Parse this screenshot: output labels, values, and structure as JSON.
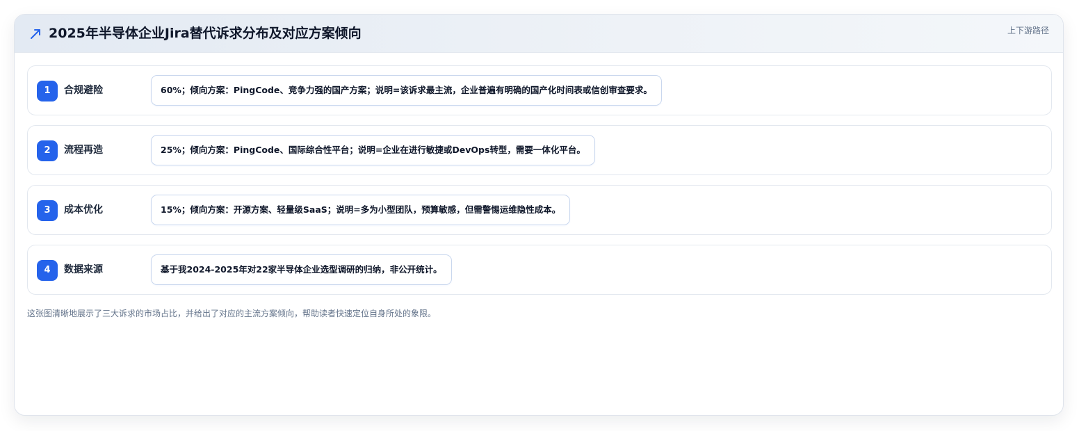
{
  "header": {
    "title": "2025年半导体企业Jira替代诉求分布及对应方案倾向",
    "tag": "上下游路径",
    "icon": "trend-arrow-icon",
    "accent_color": "#2563eb"
  },
  "rows": [
    {
      "number": "1",
      "label": "合规避险",
      "detail": "60%；倾向方案：PingCode、竞争力强的国产方案；说明=该诉求最主流，企业普遍有明确的国产化时间表或信创审查要求。"
    },
    {
      "number": "2",
      "label": "流程再造",
      "detail": "25%；倾向方案：PingCode、国际综合性平台；说明=企业在进行敏捷或DevOps转型，需要一体化平台。"
    },
    {
      "number": "3",
      "label": "成本优化",
      "detail": "15%；倾向方案：开源方案、轻量级SaaS；说明=多为小型团队，预算敏感，但需警惕运维隐性成本。"
    },
    {
      "number": "4",
      "label": "数据来源",
      "detail": "基于我2024-2025年对22家半导体企业选型调研的归纳，非公开统计。"
    }
  ],
  "footnote": "这张图清晰地展示了三大诉求的市场占比，并给出了对应的主流方案倾向，帮助读者快速定位自身所处的象限。"
}
